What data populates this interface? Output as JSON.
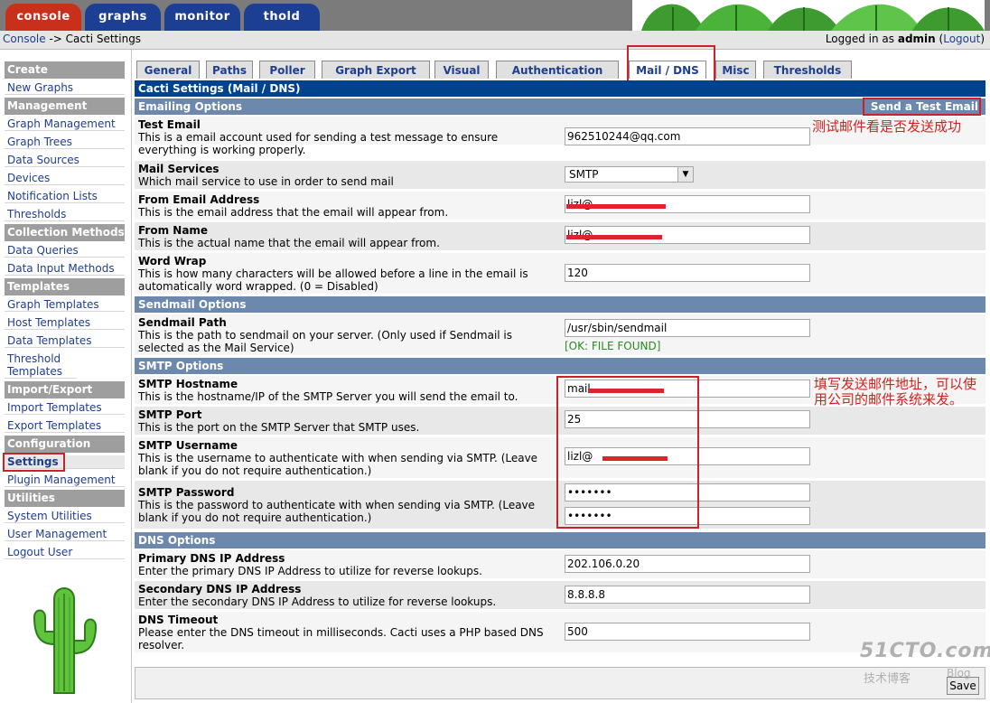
{
  "top_tabs": [
    "console",
    "graphs",
    "monitor",
    "thold"
  ],
  "breadcrumb": {
    "link": "Console",
    "separator": " -> ",
    "current": "Cacti Settings"
  },
  "login": {
    "prefix": "Logged in as ",
    "user": "admin",
    "logout": "Logout"
  },
  "sidebar": {
    "create": {
      "header": "Create",
      "items": [
        "New Graphs"
      ]
    },
    "management": {
      "header": "Management",
      "items": [
        "Graph Management",
        "Graph Trees",
        "Data Sources",
        "Devices",
        "Notification Lists",
        "Thresholds"
      ]
    },
    "collection": {
      "header": "Collection Methods",
      "items": [
        "Data Queries",
        "Data Input Methods"
      ]
    },
    "templates": {
      "header": "Templates",
      "items": [
        "Graph Templates",
        "Host Templates",
        "Data Templates",
        "Threshold Templates"
      ]
    },
    "import_export": {
      "header": "Import/Export",
      "items": [
        "Import Templates",
        "Export Templates"
      ]
    },
    "configuration": {
      "header": "Configuration",
      "items": [
        "Settings",
        "Plugin Management"
      ]
    },
    "utilities": {
      "header": "Utilities",
      "items": [
        "System Utilities",
        "User Management",
        "Logout User"
      ]
    }
  },
  "settings_tabs": [
    "General",
    "Paths",
    "Poller",
    "Graph Export",
    "Visual",
    "Authentication",
    "Mail / DNS",
    "Misc",
    "Thresholds"
  ],
  "page_title": "Cacti Settings (Mail / DNS)",
  "sections": {
    "emailing": "Emailing Options",
    "sendmail": "Sendmail Options",
    "smtp": "SMTP Options",
    "dns": "DNS Options"
  },
  "send_test_email": "Send a Test Email",
  "fields": {
    "test_email": {
      "title": "Test Email",
      "desc": "This is a email account used for sending a test message to ensure everything is working properly.",
      "value": "962510244@qq.com"
    },
    "mail_services": {
      "title": "Mail Services",
      "desc": "Which mail service to use in order to send mail",
      "value": "SMTP"
    },
    "from_email": {
      "title": "From Email Address",
      "desc": "This is the email address that the email will appear from.",
      "value": "lizl@"
    },
    "from_name": {
      "title": "From Name",
      "desc": "This is the actual name that the email will appear from.",
      "value": "lizl@"
    },
    "word_wrap": {
      "title": "Word Wrap",
      "desc": "This is how many characters will be allowed before a line in the email is automatically word wrapped. (0 = Disabled)",
      "value": "120"
    },
    "sendmail_path": {
      "title": "Sendmail Path",
      "desc": "This is the path to sendmail on your server. (Only used if Sendmail is selected as the Mail Service)",
      "value": "/usr/sbin/sendmail",
      "status": "[OK: FILE FOUND]"
    },
    "smtp_hostname": {
      "title": "SMTP Hostname",
      "desc": "This is the hostname/IP of the SMTP Server you will send the email to.",
      "value": "mail"
    },
    "smtp_port": {
      "title": "SMTP Port",
      "desc": "This is the port on the SMTP Server that SMTP uses.",
      "value": "25"
    },
    "smtp_username": {
      "title": "SMTP Username",
      "desc": "This is the username to authenticate with when sending via SMTP. (Leave blank if you do not require authentication.)",
      "value": "lizl@"
    },
    "smtp_password": {
      "title": "SMTP Password",
      "desc": "This is the password to authenticate with when sending via SMTP. (Leave blank if you do not require authentication.)",
      "value": "•••••••",
      "confirm": "•••••••"
    },
    "dns_primary": {
      "title": "Primary DNS IP Address",
      "desc": "Enter the primary DNS IP Address to utilize for reverse lookups.",
      "value": "202.106.0.20"
    },
    "dns_secondary": {
      "title": "Secondary DNS IP Address",
      "desc": "Enter the secondary DNS IP Address to utilize for reverse lookups.",
      "value": "8.8.8.8"
    },
    "dns_timeout": {
      "title": "DNS Timeout",
      "desc": "Please enter the DNS timeout in milliseconds. Cacti uses a PHP based DNS resolver.",
      "value": "500"
    }
  },
  "annotations": {
    "test_email_note": "测试邮件看是否发送成功",
    "smtp_note": "填写发送邮件地址，可以使用公司的邮件系统来发。"
  },
  "save_label": "Save",
  "watermark": {
    "line1": "51CTO.com",
    "line2": "技术博客",
    "line3": "Blog"
  },
  "colors": {
    "title_bar": "#00438c",
    "section_bar": "#6d88ad",
    "sidebar_header": "#9e9e9e",
    "annotation": "#d0231f",
    "active_top_tab": "#c9301b"
  }
}
